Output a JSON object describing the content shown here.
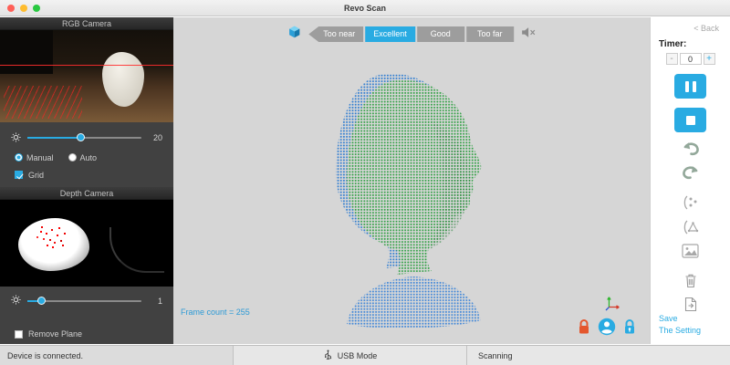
{
  "window": {
    "title": "Revo Scan"
  },
  "left_panel": {
    "rgb_camera": {
      "header": "RGB Camera",
      "brightness": "20",
      "manual_label": "Manual",
      "auto_label": "Auto",
      "grid_label": "Grid"
    },
    "depth_camera": {
      "header": "Depth Camera",
      "brightness": "1",
      "remove_plane_label": "Remove Plane"
    }
  },
  "main": {
    "distance": {
      "options": [
        "Too near",
        "Excellent",
        "Good",
        "Too far"
      ],
      "selected": "Excellent"
    },
    "frame_count": "Frame count = 255"
  },
  "right_panel": {
    "back_label": "< Back",
    "timer_label": "Timer:",
    "timer_value": "0",
    "minus_label": "-",
    "plus_label": "+",
    "save_line1": "Save",
    "save_line2": "The Setting"
  },
  "status_bar": {
    "device": "Device is connected.",
    "usb_mode": "USB Mode",
    "scanning": "Scanning"
  },
  "colors": {
    "accent": "#29abe2",
    "excellent": "#29abe2",
    "segment_gray": "#9d9d9d"
  }
}
